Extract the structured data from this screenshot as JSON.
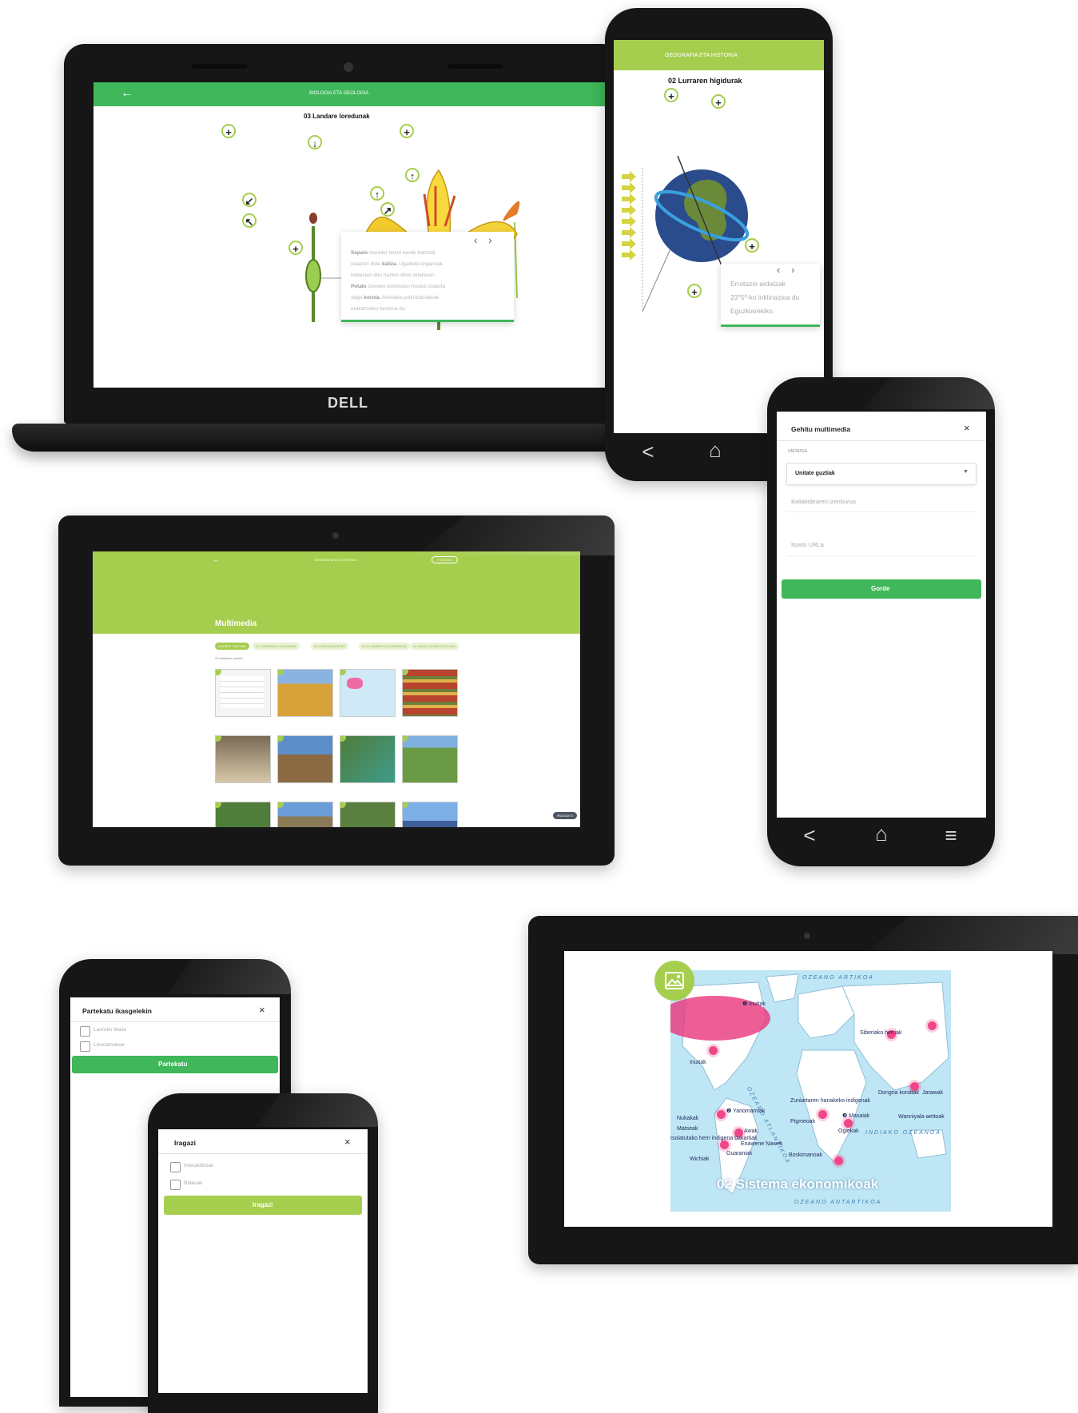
{
  "laptop": {
    "brand": "DELL",
    "header_title": "BIOLOGIA ETA GEOLOGIA",
    "back_label": "←",
    "unit_title": "03 Landare loredunak",
    "info_card": {
      "prev": "‹",
      "next": "›",
      "bold1": "Sepalo",
      "text1": " izeneko hosto berde batzuek",
      "text2": "osatzen dute ",
      "bold2": "kaliza.",
      "text3": " Ugalketa organoak",
      "text4": "babesten ditu hazten diren bitartean.",
      "bold3": "Petalo",
      "text5": " izeneko koloredun hostoz osatuta",
      "text6": "dago ",
      "bold4": "korola.",
      "text7": " Animalia polinizatzaileak",
      "text8": "erakartzeko funtzioa du."
    }
  },
  "phone_geo": {
    "header_title": "GEOGRAFIA ETA HISTORIA",
    "unit_title": "02 Lurraren higidurak",
    "card_lines": [
      "Errotazio ardatzak",
      "23°5º-ko inklinazioa du",
      "Eguzkiarekiko."
    ],
    "prev": "‹",
    "next": "›",
    "nav": [
      "<",
      "⌂"
    ]
  },
  "phone_multimedia": {
    "title": "Gehitu multimedia",
    "close": "×",
    "unit_label": "UNITATEA",
    "unit_value": "Unitate guztiak",
    "name_placeholder": "Baliabidearen izenburua",
    "url_placeholder": "Itsatsi URLa",
    "save_label": "Gorde",
    "nav": [
      "<",
      "⌂",
      "≡"
    ]
  },
  "tablet_multimedia": {
    "header_title": "GEOGRAFIA ETA HISTORIA",
    "header_button": "+ GEHITU",
    "page_title": "Multimedia",
    "chips": [
      "UNITATE GUZTIAK",
      "01 LURRAREN HIGIDURAK",
      "02 LURRA MAPETAN",
      "03 KLIMAREN EZAUGARRIAK",
      "04 IRAULTZAREN HISTORIA"
    ],
    "count": "24 baliabide aurkitu",
    "filter_button": "IRAGAZI ⊙"
  },
  "phone_share": {
    "title": "Partekatu ikasgelekin",
    "close": "×",
    "options": [
      "Lanreko Maila",
      "Lizeoamekoe"
    ],
    "button": "Partekatu"
  },
  "phone_filter": {
    "title": "Iragazi",
    "close": "×",
    "options": [
      "Interaktiboak",
      "Bideoak"
    ],
    "button": "Iragazi"
  },
  "tablet_map": {
    "banner": "02 Sistema ekonomikoak",
    "ocean_labels": {
      "artic": "OZEANO ARTIKOA",
      "atlantic": "OZEANO ATLANTIKOA",
      "indian": "INDIAKO OZEANOA",
      "antarctic": "OZEANO ANTARTIKOA"
    },
    "place_labels": [
      "❶ Inuitak",
      "Inuitak",
      "Siberiako herriak",
      "Dongria kondtak",
      "Jarawak",
      "Zuniartaren hanakeko indigenak",
      "❷ Yanomamiak",
      "❸ Masaiak",
      "Wanniyala-aettoak",
      "Nukakak",
      "Matseak",
      "Isolatutako herri indigena bakartiak",
      "Awak",
      "Enawene Nawek",
      "Pigmeoak",
      "Ogiekak",
      "Wichiak",
      "Guaraniak",
      "Boskimanoak"
    ]
  },
  "colors": {
    "green": "#3fb75a",
    "lime": "#a6ce4e",
    "pin": "#f0478a",
    "map_sea": "#bfe6f5",
    "map_land": "#ffffff"
  }
}
